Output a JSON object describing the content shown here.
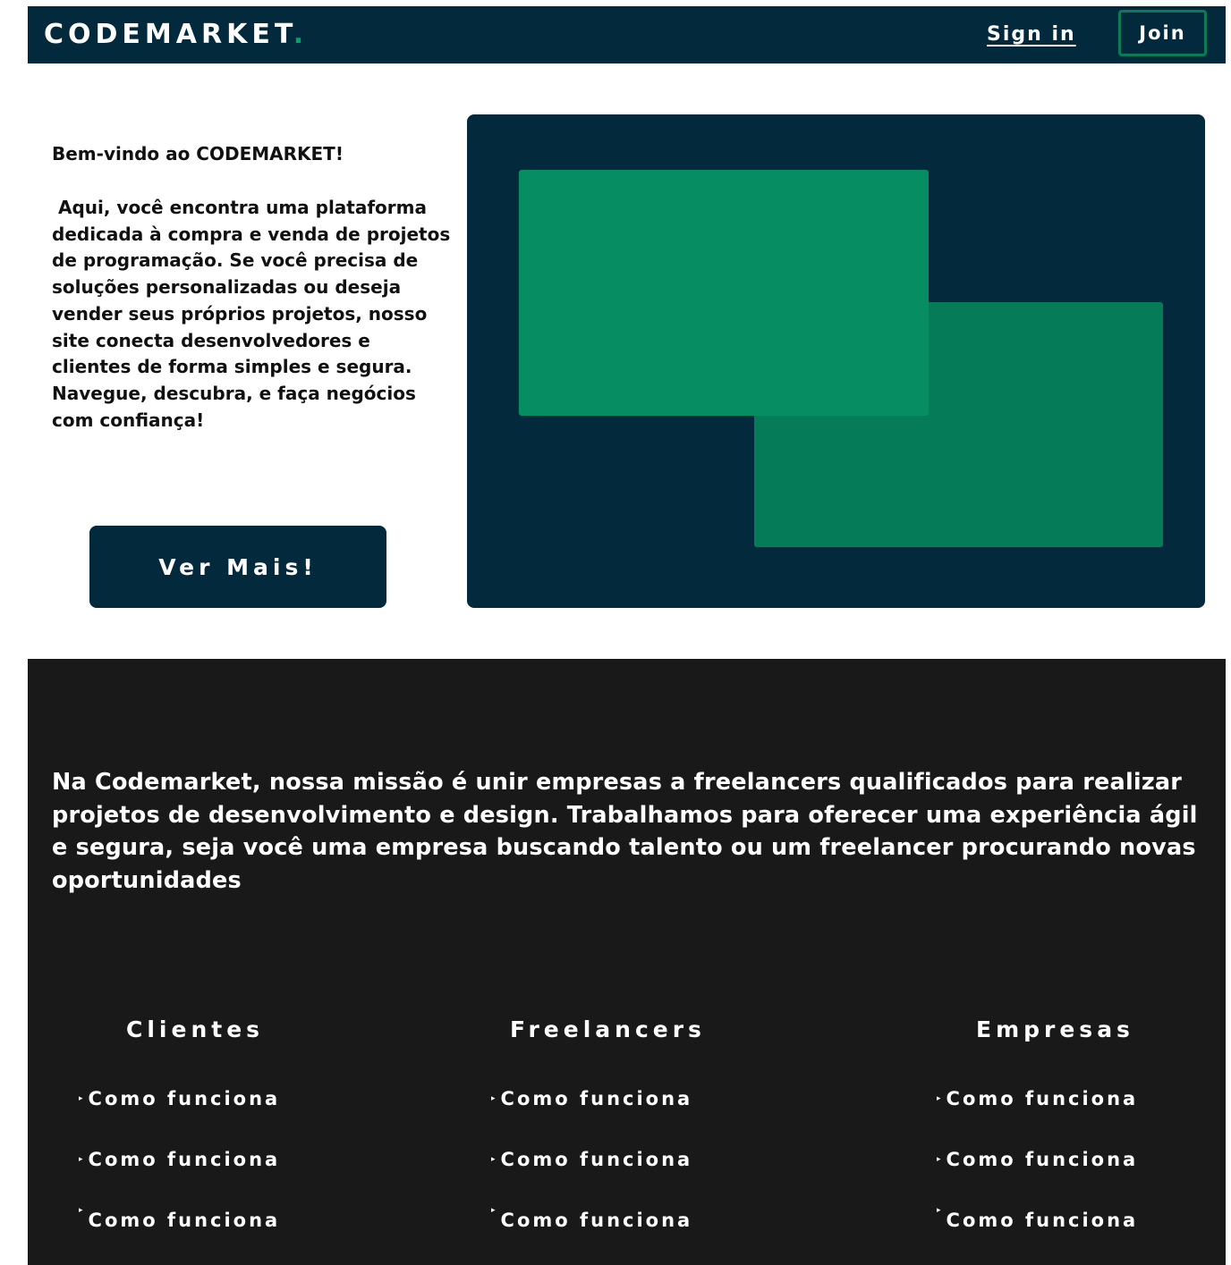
{
  "navbar": {
    "logo_text": "CODEMARKET",
    "logo_dot": ".",
    "signin_label": "Sign in",
    "join_label": "Join"
  },
  "hero": {
    "welcome_title": "Bem-vindo ao CODEMARKET!",
    "intro_text": " Aqui, você encontra uma plataforma dedicada à compra e venda de projetos de programação. Se você precisa de soluções personalizadas ou deseja vender seus próprios projetos, nosso site conecta desenvolvedores e clientes de forma simples e segura. Navegue, descubra, e faça negócios com confiança!",
    "cta_label": "Ver Mais!"
  },
  "footer": {
    "mission_text": "Na Codemarket, nossa missão é unir empresas a freelancers qualificados para realizar projetos de desenvolvimento e design. Trabalhamos para oferecer uma experiência ágil e segura, seja você uma empresa buscando talento ou um freelancer procurando novas oportunidades",
    "columns": [
      {
        "title": "Clientes",
        "links": [
          "Como funciona",
          "Como funciona",
          "Como funciona"
        ]
      },
      {
        "title": "Freelancers",
        "links": [
          "Como funciona",
          "Como funciona",
          "Como funciona"
        ]
      },
      {
        "title": "Empresas",
        "links": [
          "Como funciona",
          "Como funciona",
          "Como funciona"
        ]
      }
    ]
  },
  "colors": {
    "navy": "#022a3c",
    "green": "#068d61",
    "green_dark": "#067b57",
    "footer_bg": "#191919"
  },
  "icons": {
    "link_bullet": "triangle-right-icon"
  }
}
